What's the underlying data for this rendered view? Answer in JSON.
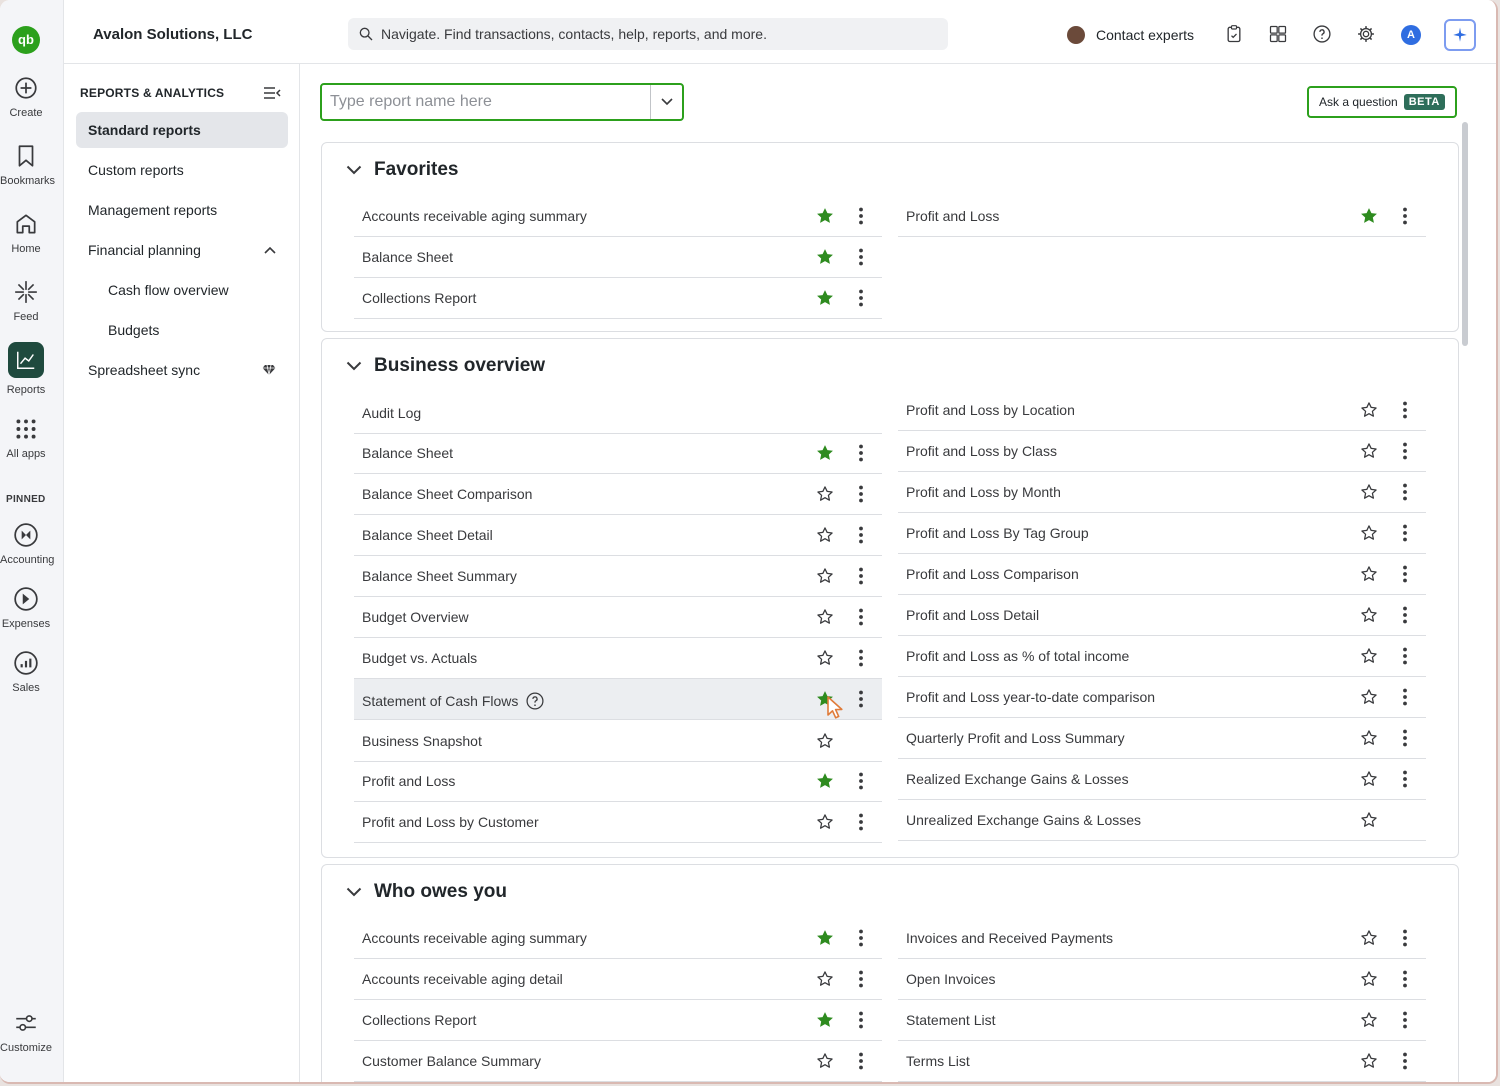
{
  "company": "Avalon Solutions, LLC",
  "search": {
    "placeholder": "Navigate. Find transactions, contacts, help, reports, and more."
  },
  "topbar": {
    "contact_label": "Contact experts",
    "avatar_letter": "A"
  },
  "rail": {
    "logo": "qb",
    "items": [
      {
        "label": "Create",
        "icon": "plus-circle-icon"
      },
      {
        "label": "Bookmarks",
        "icon": "bookmark-icon"
      },
      {
        "label": "Home",
        "icon": "home-icon"
      },
      {
        "label": "Feed",
        "icon": "sparkle-icon"
      },
      {
        "label": "Reports",
        "icon": "chart-line-icon",
        "active": true
      },
      {
        "label": "All apps",
        "icon": "grid-icon"
      }
    ],
    "pinned_label": "PINNED",
    "pinned": [
      {
        "label": "Accounting",
        "icon": "accounting-icon"
      },
      {
        "label": "Expenses",
        "icon": "expenses-icon"
      },
      {
        "label": "Sales",
        "icon": "sales-icon"
      }
    ],
    "customize": "Customize"
  },
  "sidebar": {
    "title": "REPORTS & ANALYTICS",
    "items": [
      {
        "label": "Standard reports",
        "active": true
      },
      {
        "label": "Custom reports"
      },
      {
        "label": "Management reports"
      },
      {
        "label": "Financial planning",
        "expanded": true
      },
      {
        "label": "Cash flow overview",
        "sub": true
      },
      {
        "label": "Budgets",
        "sub": true
      },
      {
        "label": "Spreadsheet sync",
        "badge": "diamond-icon"
      }
    ]
  },
  "main": {
    "report_search_placeholder": "Type report name here",
    "ask_label": "Ask a question",
    "beta_label": "BETA",
    "sections": [
      {
        "title": "Favorites",
        "left": [
          {
            "name": "Accounts receivable aging summary",
            "fav": true
          },
          {
            "name": "Balance Sheet",
            "fav": true
          },
          {
            "name": "Collections Report",
            "fav": true
          }
        ],
        "right": [
          {
            "name": "Profit and Loss",
            "fav": true
          }
        ]
      },
      {
        "title": "Business overview",
        "left": [
          {
            "name": "Audit Log",
            "noactions": true
          },
          {
            "name": "Balance Sheet",
            "fav": true
          },
          {
            "name": "Balance Sheet Comparison",
            "fav": false
          },
          {
            "name": "Balance Sheet Detail",
            "fav": false
          },
          {
            "name": "Balance Sheet Summary",
            "fav": false
          },
          {
            "name": "Budget Overview",
            "fav": false
          },
          {
            "name": "Budget vs. Actuals",
            "fav": false
          },
          {
            "name": "Statement of Cash Flows",
            "fav": true,
            "hover": true,
            "help": true
          },
          {
            "name": "Business Snapshot",
            "fav": false,
            "nokebab": true
          },
          {
            "name": "Profit and Loss",
            "fav": true
          },
          {
            "name": "Profit and Loss by Customer",
            "fav": false
          }
        ],
        "right": [
          {
            "name": "Profit and Loss by Location",
            "fav": false
          },
          {
            "name": "Profit and Loss by Class",
            "fav": false
          },
          {
            "name": "Profit and Loss by Month",
            "fav": false
          },
          {
            "name": "Profit and Loss By Tag Group",
            "fav": false
          },
          {
            "name": "Profit and Loss Comparison",
            "fav": false
          },
          {
            "name": "Profit and Loss Detail",
            "fav": false
          },
          {
            "name": "Profit and Loss as % of total income",
            "fav": false
          },
          {
            "name": "Profit and Loss year-to-date comparison",
            "fav": false
          },
          {
            "name": "Quarterly Profit and Loss Summary",
            "fav": false
          },
          {
            "name": "Realized Exchange Gains & Losses",
            "fav": false
          },
          {
            "name": "Unrealized Exchange Gains & Losses",
            "fav": false,
            "nokebab": true
          }
        ]
      },
      {
        "title": "Who owes you",
        "left": [
          {
            "name": "Accounts receivable aging summary",
            "fav": true
          },
          {
            "name": "Accounts receivable aging detail",
            "fav": false
          },
          {
            "name": "Collections Report",
            "fav": true
          },
          {
            "name": "Customer Balance Summary",
            "fav": false
          }
        ],
        "right": [
          {
            "name": "Invoices and Received Payments",
            "fav": false
          },
          {
            "name": "Open Invoices",
            "fav": false
          },
          {
            "name": "Statement List",
            "fav": false
          },
          {
            "name": "Terms List",
            "fav": false
          }
        ]
      }
    ]
  },
  "colors": {
    "brand_green": "#2ca01c",
    "star_fill": "#2e8b1f",
    "reports_active": "#1f4a3e"
  }
}
